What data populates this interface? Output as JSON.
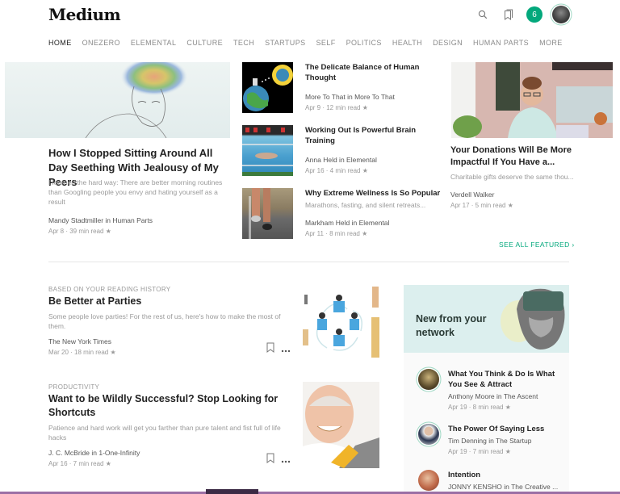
{
  "header": {
    "logo": "Medium",
    "notification_count": "6",
    "icons": [
      "search-icon",
      "bookmarks-icon",
      "notifications-badge",
      "user-avatar"
    ]
  },
  "nav": {
    "items": [
      "HOME",
      "ONEZERO",
      "ELEMENTAL",
      "CULTURE",
      "TECH",
      "STARTUPS",
      "SELF",
      "POLITICS",
      "HEALTH",
      "DESIGN",
      "HUMAN PARTS",
      "MORE"
    ],
    "active": "HOME"
  },
  "featured": {
    "main": {
      "title": "How I Stopped Sitting Around All Day Seething With Jealousy of My Peers",
      "subtitle": "I learned the hard way: There are better morning routines than Googling people you envy and hating yourself as a result",
      "author": "Mandy Stadtmiller in Human Parts",
      "meta": "Apr 8 · 39 min read ★"
    },
    "middle": [
      {
        "title": "The Delicate Balance of Human Thought",
        "subtitle": "",
        "author": "More To That in More To That",
        "meta": "Apr 9 · 12 min read ★"
      },
      {
        "title": "Working Out Is Powerful Brain Training",
        "subtitle": "",
        "author": "Anna Held in Elemental",
        "meta": "Apr 16 · 4 min read ★"
      },
      {
        "title": "Why Extreme Wellness Is So Popular",
        "subtitle": "Marathons, fasting, and silent retreats...",
        "author": "Markham Held in Elemental",
        "meta": "Apr 11 · 8 min read ★"
      }
    ],
    "right": {
      "title": "Your Donations Will Be More Impactful If You Have a...",
      "subtitle": "Charitable gifts deserve the same thou...",
      "author": "Verdell Walker",
      "meta": "Apr 17 · 5 min read ★"
    },
    "see_all": "SEE ALL FEATURED ›"
  },
  "feed": [
    {
      "kicker": "BASED ON YOUR READING HISTORY",
      "title": "Be Better at Parties",
      "subtitle": "Some people love parties! For the rest of us, here's how to make the most of them.",
      "author": "The New York Times",
      "meta": "Mar 20 · 18 min read ★"
    },
    {
      "kicker": "PRODUCTIVITY",
      "title": "Want to be Wildly Successful? Stop Looking for Shortcuts",
      "subtitle": "Patience and hard work will get you farther than pure talent and fist full of life hacks",
      "author": "J. C. McBride in 1-One-Infinity",
      "meta": "Apr 16 · 7 min read ★"
    }
  ],
  "network": {
    "title": "New from your network",
    "items": [
      {
        "title": "What You Think & Do Is What You See & Attract",
        "author": "Anthony Moore in The Ascent",
        "meta": "Apr 19 · 8 min read ★"
      },
      {
        "title": "The Power Of Saying Less",
        "author": "Tim Denning in The Startup",
        "meta": "Apr 19 · 7 min read ★"
      },
      {
        "title": "Intention",
        "author": "JONNY KENSHO in The Creative ...",
        "meta": ""
      }
    ]
  },
  "colors": {
    "accent": "#03a87c",
    "network_bg": "#dcefee"
  }
}
